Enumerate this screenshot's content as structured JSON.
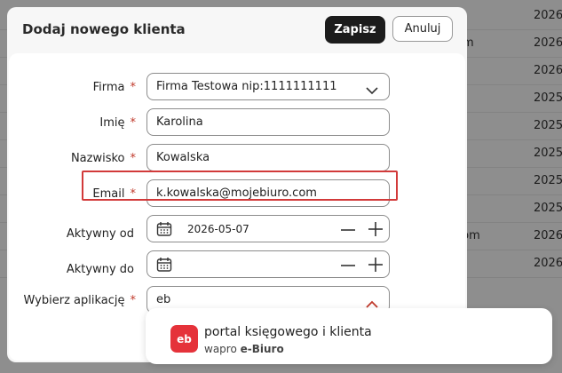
{
  "background_table": {
    "rows": [
      {
        "c1": "m",
        "c2": "2026"
      },
      {
        "c1": "om",
        "c2": "2026"
      },
      {
        "c1": "n",
        "c2": "2026"
      },
      {
        "c1": "",
        "c2": "2025"
      },
      {
        "c1": "",
        "c2": "2025"
      },
      {
        "c1": "",
        "c2": "2025"
      },
      {
        "c1": "",
        "c2": "2025"
      },
      {
        "c1": "n",
        "c2": "2025"
      },
      {
        "c1": "com",
        "c2": "2026"
      },
      {
        "c1": "e",
        "c2": "2026"
      }
    ]
  },
  "modal": {
    "title": "Dodaj nowego klienta",
    "save_label": "Zapisz",
    "cancel_label": "Anuluj"
  },
  "form": {
    "required_mark": "*",
    "firma": {
      "label": "Firma",
      "value": "Firma Testowa nip:1111111111"
    },
    "imie": {
      "label": "Imię",
      "value": "Karolina"
    },
    "nazwisko": {
      "label": "Nazwisko",
      "value": "Kowalska"
    },
    "email": {
      "label": "Email",
      "value": "k.kowalska@mojebiuro.com"
    },
    "aktywny_od": {
      "label": "Aktywny od",
      "value": "2026-05-07"
    },
    "aktywny_do": {
      "label": "Aktywny do",
      "value": ""
    },
    "aplikacja": {
      "label": "Wybierz aplikację",
      "value": "eb"
    }
  },
  "dropdown": {
    "option": {
      "logo_text": "eb",
      "name": "portal księgowego i klienta",
      "brand_prefix": "wapro",
      "brand_name": "e-Biuro"
    }
  },
  "colors": {
    "accent": "#1c1c1c",
    "required": "#c0392b",
    "highlight": "#d23a3a",
    "app_logo": "#e5323a"
  }
}
